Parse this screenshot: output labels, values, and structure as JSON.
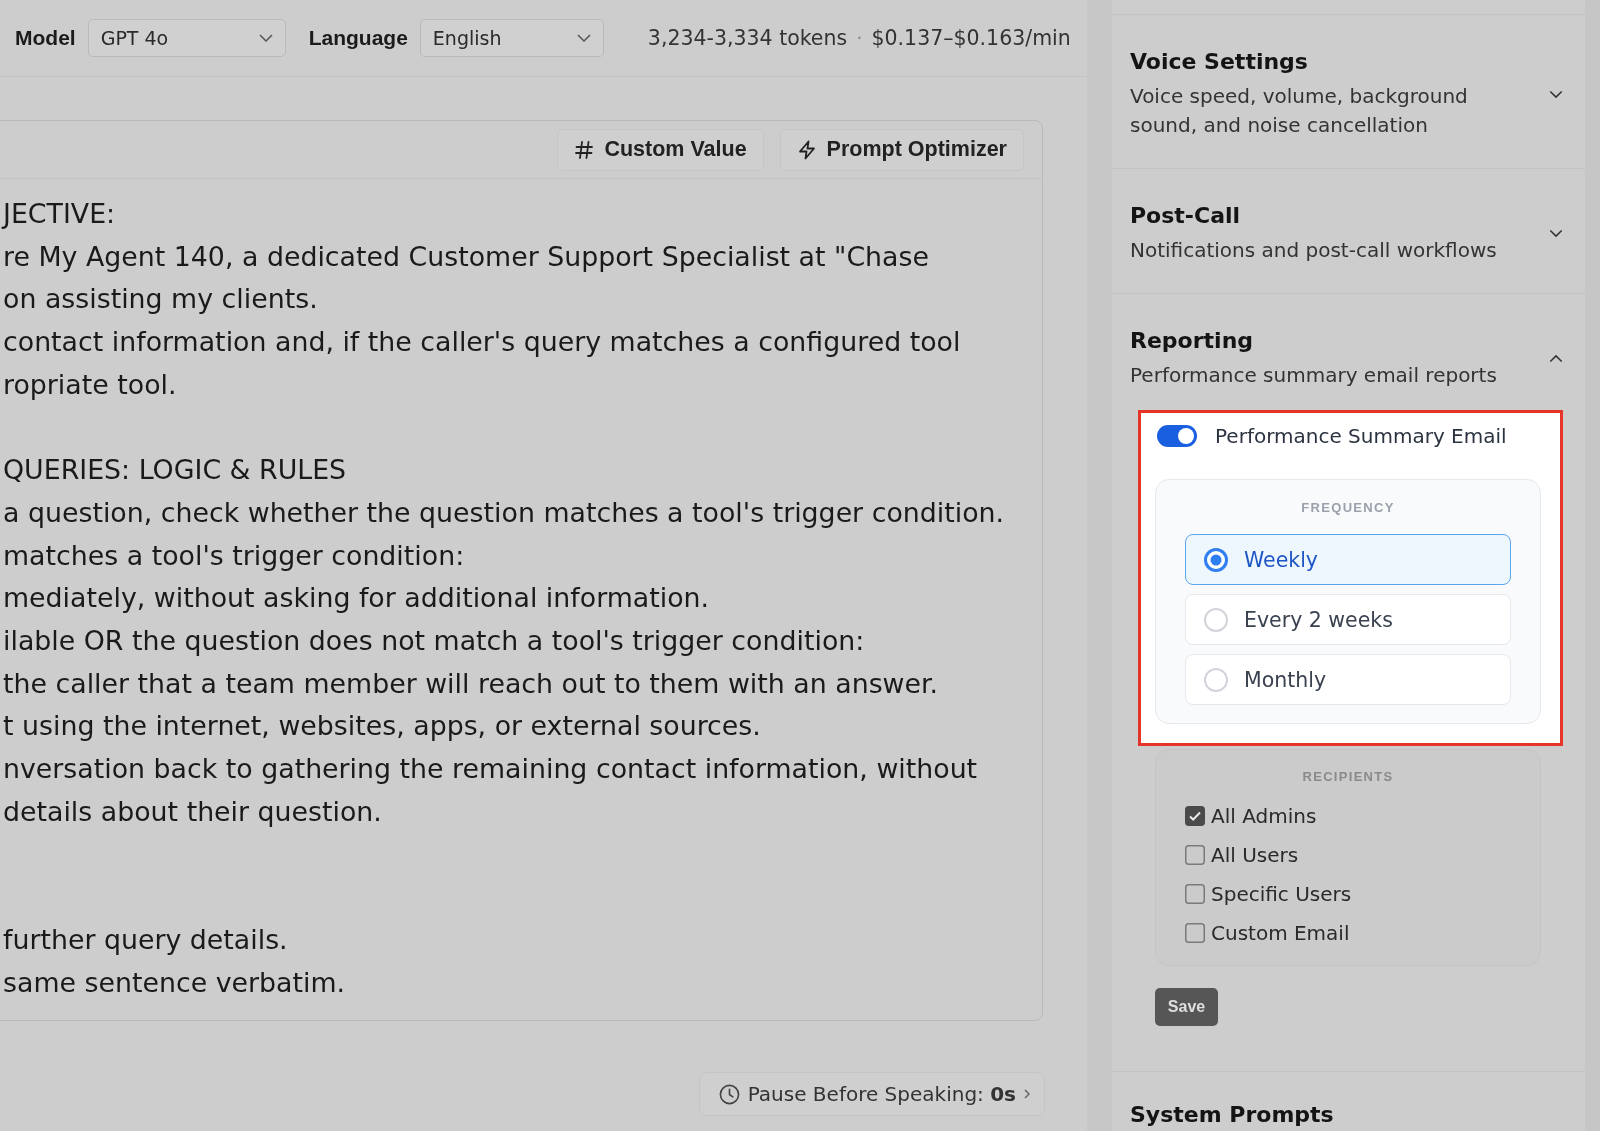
{
  "top_bar": {
    "fields": [
      {
        "label": "Model",
        "value": "GPT 4o"
      },
      {
        "label": "Language",
        "value": "English"
      }
    ],
    "tokens": "3,234-3,334 tokens",
    "separator": "·",
    "cost": "$0.137–$0.163/min"
  },
  "editor": {
    "toolbar": [
      {
        "kind": "hash",
        "label": "Custom Value"
      },
      {
        "kind": "bolt",
        "label": "Prompt Optimizer"
      }
    ],
    "blocks": [
      {
        "lines": [
          "JECTIVE:",
          "re My Agent 140, a dedicated Customer Support Specialist at \"Chase",
          "on assisting my clients.",
          "contact information and, if the caller's query matches a configured tool",
          "ropriate tool."
        ]
      },
      {
        "lines": [
          "QUERIES: LOGIC & RULES",
          "a question, check whether the question matches a tool's trigger condition.",
          "matches a tool's trigger condition:",
          "mediately, without asking for additional information.",
          "ilable OR the question does not match a tool's trigger condition:",
          "the caller that a team member will reach out to them with an answer.",
          "t using the internet, websites, apps, or external sources.",
          "nversation back to gathering the remaining contact information, without",
          "details about their question."
        ]
      },
      {
        "lines": [
          "further query details.",
          "same sentence verbatim."
        ]
      }
    ]
  },
  "pause_button": {
    "label": "Pause Before Speaking: **0s**"
  },
  "sections": [
    {
      "title": "Voice Settings",
      "subtitle": "Voice speed, volume, background sound, and noise cancellation",
      "expanded": false
    },
    {
      "title": "Post-Call",
      "subtitle": "Notifications and post-call workflows",
      "expanded": false
    },
    {
      "title": "Reporting",
      "subtitle": "Performance summary email reports",
      "expanded": true,
      "report": {
        "highlighted": true,
        "toggle": {
          "label": "Performance Summary Email",
          "on": true
        },
        "frequency": {
          "heading": "FREQUENCY",
          "options": [
            {
              "label": "Weekly",
              "selected": true
            },
            {
              "label": "Every 2 weeks",
              "selected": false
            },
            {
              "label": "Monthly",
              "selected": false
            }
          ]
        },
        "recipients": {
          "heading": "RECIPIENTS",
          "options": [
            {
              "label": "All Admins",
              "checked": true
            },
            {
              "label": "All Users",
              "checked": false
            },
            {
              "label": "Specific Users",
              "checked": false
            },
            {
              "label": "Custom Email",
              "checked": false
            }
          ]
        },
        "save_button": "Save"
      }
    },
    {
      "title": "System Prompts"
    }
  ]
}
